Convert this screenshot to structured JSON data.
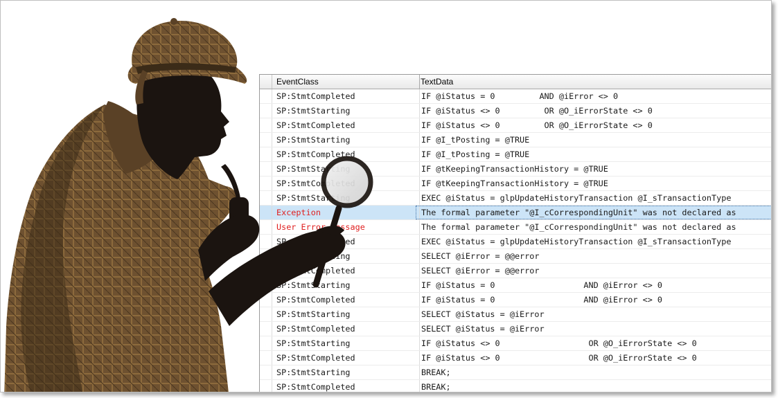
{
  "grid": {
    "columns": [
      "EventClass",
      "TextData"
    ],
    "rows": [
      {
        "event": "SP:StmtCompleted",
        "text": "IF @iStatus = 0         AND @iError <> 0"
      },
      {
        "event": "SP:StmtStarting",
        "text": "IF @iStatus <> 0         OR @O_iErrorState <> 0"
      },
      {
        "event": "SP:StmtCompleted",
        "text": "IF @iStatus <> 0         OR @O_iErrorState <> 0"
      },
      {
        "event": "SP:StmtStarting",
        "text": "IF @I_tPosting = @TRUE"
      },
      {
        "event": "SP:StmtCompleted",
        "text": "IF @I_tPosting = @TRUE"
      },
      {
        "event": "SP:StmtStarting",
        "text": "IF @tKeepingTransactionHistory = @TRUE"
      },
      {
        "event": "SP:StmtCompleted",
        "text": "IF @tKeepingTransactionHistory = @TRUE"
      },
      {
        "event": "SP:StmtStarting",
        "text": "EXEC @iStatus = glpUpdateHistoryTransaction @I_sTransactionType"
      },
      {
        "event": "Exception",
        "text": "The formal parameter \"@I_cCorrespondingUnit\" was not declared as",
        "error": true,
        "selected": true
      },
      {
        "event": "User Error Message",
        "text": "The formal parameter \"@I_cCorrespondingUnit\" was not declared as",
        "error": true
      },
      {
        "event": "SP:StmtCompleted",
        "text": "EXEC @iStatus = glpUpdateHistoryTransaction @I_sTransactionType"
      },
      {
        "event": "SP:StmtStarting",
        "text": "SELECT @iError = @@error"
      },
      {
        "event": "SP:StmtCompleted",
        "text": "SELECT @iError = @@error"
      },
      {
        "event": "SP:StmtStarting",
        "text": "IF @iStatus = 0                  AND @iError <> 0"
      },
      {
        "event": "SP:StmtCompleted",
        "text": "IF @iStatus = 0                  AND @iError <> 0"
      },
      {
        "event": "SP:StmtStarting",
        "text": "SELECT @iStatus = @iError"
      },
      {
        "event": "SP:StmtCompleted",
        "text": "SELECT @iStatus = @iError"
      },
      {
        "event": "SP:StmtStarting",
        "text": "IF @iStatus <> 0                  OR @O_iErrorState <> 0"
      },
      {
        "event": "SP:StmtCompleted",
        "text": "IF @iStatus <> 0                  OR @O_iErrorState <> 0"
      },
      {
        "event": "SP:StmtStarting",
        "text": "BREAK;"
      },
      {
        "event": "SP:StmtCompleted",
        "text": "BREAK;"
      }
    ]
  },
  "colors": {
    "error_text": "#e02020",
    "selected_row": "#cce4f7",
    "silhouette": "#1b1410",
    "coat_tweed": "#7a5a30"
  },
  "icons": [
    "detective-silhouette",
    "magnifying-glass-icon",
    "pipe-icon",
    "deerstalker-hat-icon"
  ]
}
